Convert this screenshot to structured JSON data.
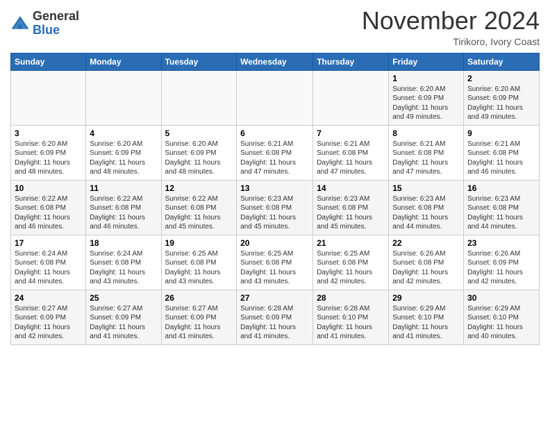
{
  "header": {
    "logo_general": "General",
    "logo_blue": "Blue",
    "month_title": "November 2024",
    "subtitle": "Tirikoro, Ivory Coast"
  },
  "weekdays": [
    "Sunday",
    "Monday",
    "Tuesday",
    "Wednesday",
    "Thursday",
    "Friday",
    "Saturday"
  ],
  "weeks": [
    [
      {
        "day": "",
        "info": ""
      },
      {
        "day": "",
        "info": ""
      },
      {
        "day": "",
        "info": ""
      },
      {
        "day": "",
        "info": ""
      },
      {
        "day": "",
        "info": ""
      },
      {
        "day": "1",
        "info": "Sunrise: 6:20 AM\nSunset: 6:09 PM\nDaylight: 11 hours and 49 minutes."
      },
      {
        "day": "2",
        "info": "Sunrise: 6:20 AM\nSunset: 6:09 PM\nDaylight: 11 hours and 49 minutes."
      }
    ],
    [
      {
        "day": "3",
        "info": "Sunrise: 6:20 AM\nSunset: 6:09 PM\nDaylight: 11 hours and 48 minutes."
      },
      {
        "day": "4",
        "info": "Sunrise: 6:20 AM\nSunset: 6:09 PM\nDaylight: 11 hours and 48 minutes."
      },
      {
        "day": "5",
        "info": "Sunrise: 6:20 AM\nSunset: 6:09 PM\nDaylight: 11 hours and 48 minutes."
      },
      {
        "day": "6",
        "info": "Sunrise: 6:21 AM\nSunset: 6:08 PM\nDaylight: 11 hours and 47 minutes."
      },
      {
        "day": "7",
        "info": "Sunrise: 6:21 AM\nSunset: 6:08 PM\nDaylight: 11 hours and 47 minutes."
      },
      {
        "day": "8",
        "info": "Sunrise: 6:21 AM\nSunset: 6:08 PM\nDaylight: 11 hours and 47 minutes."
      },
      {
        "day": "9",
        "info": "Sunrise: 6:21 AM\nSunset: 6:08 PM\nDaylight: 11 hours and 46 minutes."
      }
    ],
    [
      {
        "day": "10",
        "info": "Sunrise: 6:22 AM\nSunset: 6:08 PM\nDaylight: 11 hours and 46 minutes."
      },
      {
        "day": "11",
        "info": "Sunrise: 6:22 AM\nSunset: 6:08 PM\nDaylight: 11 hours and 46 minutes."
      },
      {
        "day": "12",
        "info": "Sunrise: 6:22 AM\nSunset: 6:08 PM\nDaylight: 11 hours and 45 minutes."
      },
      {
        "day": "13",
        "info": "Sunrise: 6:23 AM\nSunset: 6:08 PM\nDaylight: 11 hours and 45 minutes."
      },
      {
        "day": "14",
        "info": "Sunrise: 6:23 AM\nSunset: 6:08 PM\nDaylight: 11 hours and 45 minutes."
      },
      {
        "day": "15",
        "info": "Sunrise: 6:23 AM\nSunset: 6:08 PM\nDaylight: 11 hours and 44 minutes."
      },
      {
        "day": "16",
        "info": "Sunrise: 6:23 AM\nSunset: 6:08 PM\nDaylight: 11 hours and 44 minutes."
      }
    ],
    [
      {
        "day": "17",
        "info": "Sunrise: 6:24 AM\nSunset: 6:08 PM\nDaylight: 11 hours and 44 minutes."
      },
      {
        "day": "18",
        "info": "Sunrise: 6:24 AM\nSunset: 6:08 PM\nDaylight: 11 hours and 43 minutes."
      },
      {
        "day": "19",
        "info": "Sunrise: 6:25 AM\nSunset: 6:08 PM\nDaylight: 11 hours and 43 minutes."
      },
      {
        "day": "20",
        "info": "Sunrise: 6:25 AM\nSunset: 6:08 PM\nDaylight: 11 hours and 43 minutes."
      },
      {
        "day": "21",
        "info": "Sunrise: 6:25 AM\nSunset: 6:08 PM\nDaylight: 11 hours and 42 minutes."
      },
      {
        "day": "22",
        "info": "Sunrise: 6:26 AM\nSunset: 6:08 PM\nDaylight: 11 hours and 42 minutes."
      },
      {
        "day": "23",
        "info": "Sunrise: 6:26 AM\nSunset: 6:09 PM\nDaylight: 11 hours and 42 minutes."
      }
    ],
    [
      {
        "day": "24",
        "info": "Sunrise: 6:27 AM\nSunset: 6:09 PM\nDaylight: 11 hours and 42 minutes."
      },
      {
        "day": "25",
        "info": "Sunrise: 6:27 AM\nSunset: 6:09 PM\nDaylight: 11 hours and 41 minutes."
      },
      {
        "day": "26",
        "info": "Sunrise: 6:27 AM\nSunset: 6:09 PM\nDaylight: 11 hours and 41 minutes."
      },
      {
        "day": "27",
        "info": "Sunrise: 6:28 AM\nSunset: 6:09 PM\nDaylight: 11 hours and 41 minutes."
      },
      {
        "day": "28",
        "info": "Sunrise: 6:28 AM\nSunset: 6:10 PM\nDaylight: 11 hours and 41 minutes."
      },
      {
        "day": "29",
        "info": "Sunrise: 6:29 AM\nSunset: 6:10 PM\nDaylight: 11 hours and 41 minutes."
      },
      {
        "day": "30",
        "info": "Sunrise: 6:29 AM\nSunset: 6:10 PM\nDaylight: 11 hours and 40 minutes."
      }
    ]
  ]
}
